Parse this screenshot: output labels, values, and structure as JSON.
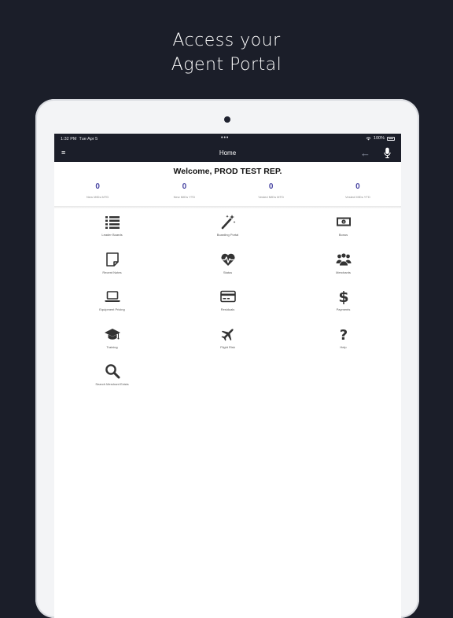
{
  "headline": {
    "line1": "Access your",
    "line2": "Agent Portal"
  },
  "statusbar": {
    "time": "1:32 PM",
    "day": "Tue Apr 5",
    "dots": "•••",
    "battery": "100%"
  },
  "navbar": {
    "menu_glyph": "≡",
    "title": "Home",
    "back_glyph": "←"
  },
  "welcome": "Welcome, PROD TEST REP.",
  "stats": [
    {
      "value": "0",
      "label": "New MIDs MTD"
    },
    {
      "value": "0",
      "label": "New MIDs YTD"
    },
    {
      "value": "0",
      "label": "Vested MIDs MTD"
    },
    {
      "value": "0",
      "label": "Vested MIDs YTD"
    }
  ],
  "tiles": [
    {
      "label": "Leader Boards",
      "icon": "list-icon"
    },
    {
      "label": "Boarding Portal",
      "icon": "magic-wand-icon"
    },
    {
      "label": "Bonus",
      "icon": "money-bill-icon"
    },
    {
      "label": "Recent Notes",
      "icon": "note-icon"
    },
    {
      "label": "Status",
      "icon": "heartbeat-icon"
    },
    {
      "label": "Merchants",
      "icon": "users-icon"
    },
    {
      "label": "Equipment Pricing",
      "icon": "laptop-icon"
    },
    {
      "label": "Residuals",
      "icon": "credit-card-icon"
    },
    {
      "label": "Payments",
      "icon": "dollar-icon"
    },
    {
      "label": "Training",
      "icon": "graduation-cap-icon"
    },
    {
      "label": "Flight Risk",
      "icon": "plane-icon"
    },
    {
      "label": "Help",
      "icon": "question-icon"
    },
    {
      "label": "Search Merchant Exists",
      "icon": "search-icon"
    }
  ],
  "colors": {
    "dark": "#1b1e29",
    "stat_value": "#4a47a3",
    "icon": "#333333"
  }
}
